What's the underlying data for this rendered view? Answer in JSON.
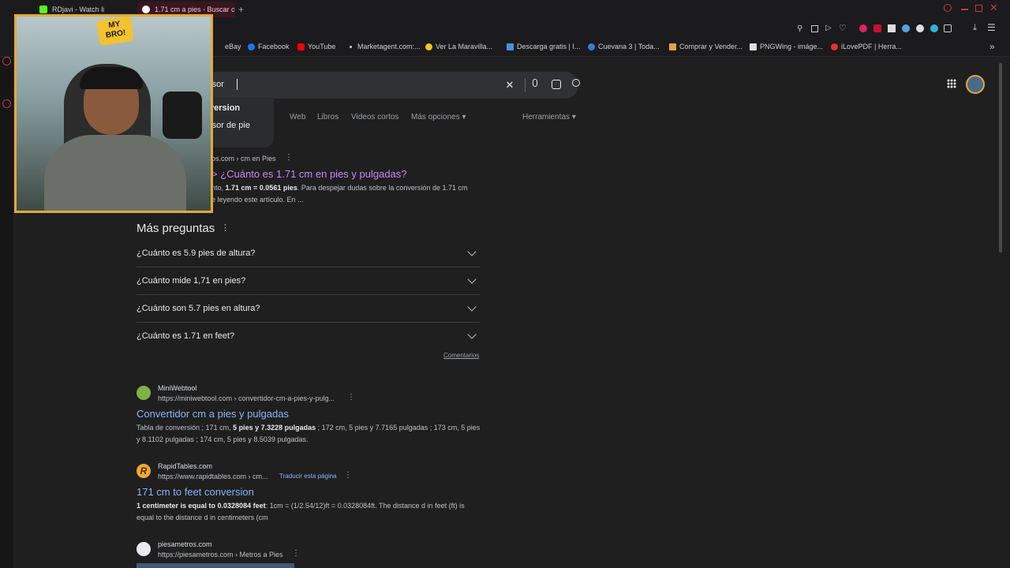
{
  "tabs": [
    {
      "title": "RDjavi - Watch li",
      "active": false
    },
    {
      "title": "1.71 cm a pies - Buscar co",
      "active": true
    }
  ],
  "bookmarks": [
    {
      "label": "eBay",
      "color": "#3b5998"
    },
    {
      "label": "Facebook",
      "color": "#1877f2"
    },
    {
      "label": "YouTube",
      "color": "#ff0000"
    },
    {
      "label": "Marketagent.com:...",
      "color": "#cccccc"
    },
    {
      "label": "Ver La Maravilla...",
      "color": "#f5c518"
    },
    {
      "label": "Descarga gratis | I...",
      "color": "#4a90e2"
    },
    {
      "label": "Cuevana 3 | Toda...",
      "color": "#3a7bd5"
    },
    {
      "label": "Comprar y Vender...",
      "color": "#e6a23c"
    },
    {
      "label": "PNGWing - imáge...",
      "color": "#333333"
    },
    {
      "label": "iLovePDF | Herra...",
      "color": "#e5322d"
    }
  ],
  "search": {
    "query": "rsor"
  },
  "suggestions": [
    "version",
    "rsor de pie"
  ],
  "filters": [
    "Web",
    "Libros",
    "Videos cortos",
    "Más opciones",
    "Herramientas"
  ],
  "top_result": {
    "breadcrumb": "os.com › cm en Pies",
    "title": "> ¿Cuánto es 1.71 cm en pies y pulgadas?",
    "snippet_pre": "nto, ",
    "snippet_bold": "1.71 cm = 0.0561 pies",
    "snippet_post": ". Para despejar dudas sobre la conversión de 1.71 cm",
    "snippet_line2": "e leyendo este artículo. En ..."
  },
  "faq": {
    "heading": "Más preguntas",
    "items": [
      "¿Cuánto es 5.9 pies de altura?",
      "¿Cuánto mide 1,71 en pies?",
      "¿Cuánto son 5.7 pies en altura?",
      "¿Cuánto es 1.71 en feet?"
    ],
    "feedback": "Comentarios"
  },
  "results": [
    {
      "site": "MiniWebtool",
      "url": "https://miniwebtool.com › convertidor-cm-a-pies-y-pulg...",
      "translate": "",
      "title": "Convertidor cm a pies y pulgadas",
      "snippet_pre": "Tabla de conversión ; 171 cm, ",
      "snippet_bold": "5 pies y 7.3228 pulgadas",
      "snippet_post": " ; 172 cm, 5 pies y 7.7165 pulgadas ; 173 cm, 5 pies y 8.1102 pulgadas ; 174 cm, 5 pies y 8.5039 pulgadas."
    },
    {
      "site": "RapidTables.com",
      "url": "https://www.rapidtables.com › cm...",
      "translate": "Traducir esta página",
      "title": "171 cm to feet conversion",
      "snippet_pre": "",
      "snippet_bold": "1 centimeter is equal to 0.0328084 feet",
      "snippet_post": ": 1cm = (1/2.54/12)ft = 0.0328084ft. The distance d in feet (ft) is equal to the distance d in centimeters (cm"
    },
    {
      "site": "piesametros.com",
      "url": "https://piesametros.com › Metros a Pies",
      "translate": "",
      "title": "",
      "snippet_pre": "",
      "snippet_bold": "",
      "snippet_post": ""
    }
  ],
  "webcam": {
    "badge_line1": "MY",
    "badge_line2": "BRO!"
  }
}
